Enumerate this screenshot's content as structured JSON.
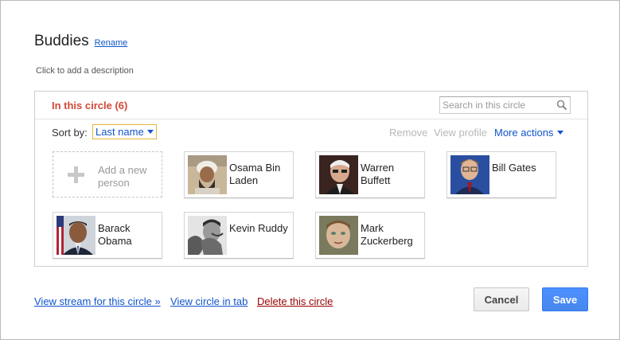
{
  "header": {
    "title": "Buddies",
    "rename_label": "Rename",
    "description_placeholder": "Click to add a description"
  },
  "circle": {
    "count_label": "In this circle (6)",
    "search_placeholder": "Search in this circle",
    "sort_label": "Sort by:",
    "sort_value": "Last name",
    "actions": {
      "remove": "Remove",
      "view_profile": "View profile",
      "more": "More actions"
    },
    "add_person_label": "Add a new person",
    "people": [
      {
        "name": "Osama Bin Laden"
      },
      {
        "name": "Warren Buffett"
      },
      {
        "name": "Bill Gates"
      },
      {
        "name": "Barack Obama"
      },
      {
        "name": "Kevin Ruddy"
      },
      {
        "name": "Mark Zuckerberg"
      }
    ]
  },
  "footer": {
    "view_stream": "View stream for this circle »",
    "view_in_tab": "View circle in tab",
    "delete": "Delete this circle",
    "cancel": "Cancel",
    "save": "Save"
  },
  "colors": {
    "accent_red": "#d14836",
    "link_blue": "#1155cc",
    "save_blue": "#4d90fe",
    "delete_red": "#990000"
  }
}
